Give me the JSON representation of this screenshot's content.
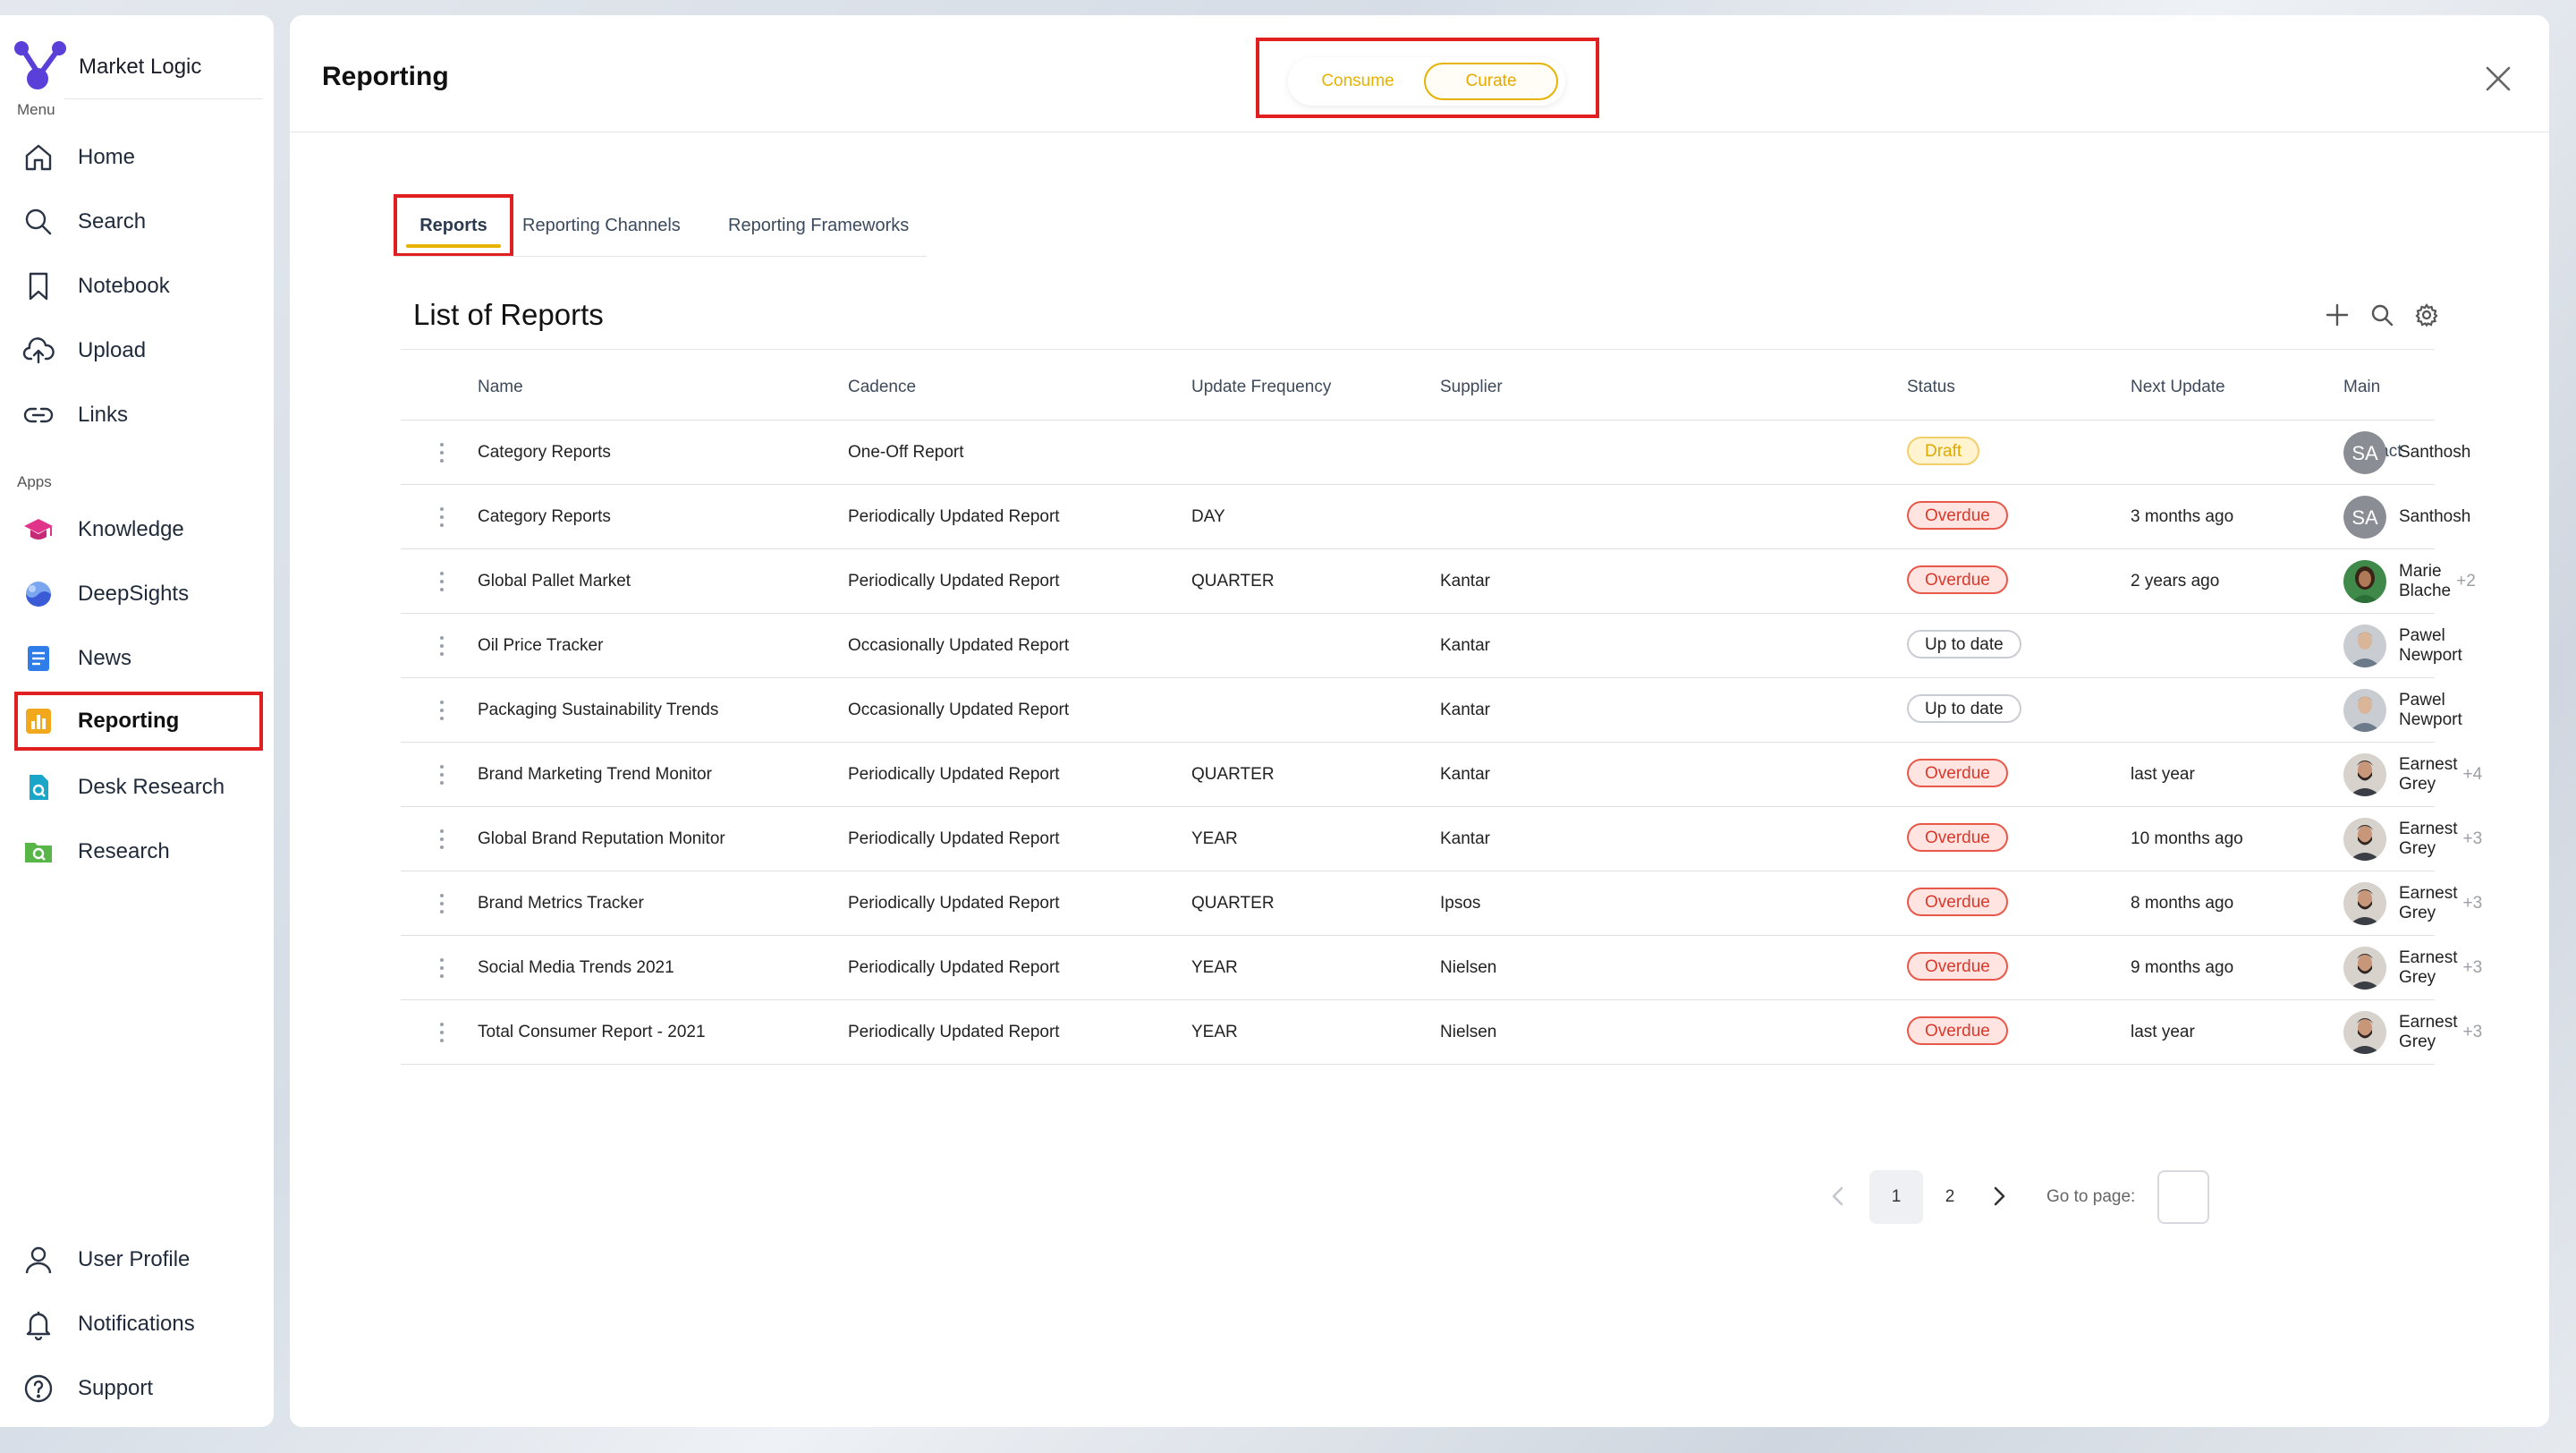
{
  "brand": {
    "name": "Market Logic"
  },
  "sidebar": {
    "menu_label": "Menu",
    "apps_label": "Apps",
    "menu_items": [
      {
        "label": "Home",
        "icon": "home-icon"
      },
      {
        "label": "Search",
        "icon": "search-icon"
      },
      {
        "label": "Notebook",
        "icon": "bookmark-icon"
      },
      {
        "label": "Upload",
        "icon": "cloud-upload-icon"
      },
      {
        "label": "Links",
        "icon": "link-icon"
      }
    ],
    "app_items": [
      {
        "label": "Knowledge",
        "icon": "graduation-cap-icon"
      },
      {
        "label": "DeepSights",
        "icon": "deepsights-icon"
      },
      {
        "label": "News",
        "icon": "news-icon"
      },
      {
        "label": "Reporting",
        "icon": "bar-chart-icon",
        "active": true
      },
      {
        "label": "Desk Research",
        "icon": "desk-research-icon"
      },
      {
        "label": "Research",
        "icon": "research-icon"
      }
    ],
    "bottom_items": [
      {
        "label": "User Profile",
        "icon": "user-icon"
      },
      {
        "label": "Notifications",
        "icon": "bell-icon"
      },
      {
        "label": "Support",
        "icon": "help-icon"
      }
    ]
  },
  "header": {
    "title": "Reporting",
    "mode_toggle": {
      "options": [
        "Consume",
        "Curate"
      ],
      "selected": "Curate"
    }
  },
  "tabs": [
    {
      "label": "Reports",
      "active": true
    },
    {
      "label": "Reporting Channels"
    },
    {
      "label": "Reporting Frameworks"
    }
  ],
  "list": {
    "title": "List of Reports",
    "columns": [
      "Name",
      "Cadence",
      "Update Frequency",
      "Supplier",
      "Status",
      "Next Update",
      "Main Contact"
    ],
    "rows": [
      {
        "name": "Category Reports",
        "cadence": "One-Off Report",
        "frequency": "",
        "supplier": "",
        "status": "Draft",
        "next_update": "",
        "contact": "Santhosh",
        "contact_extra": "",
        "avatar": "SA"
      },
      {
        "name": "Category Reports",
        "cadence": "Periodically Updated Report",
        "frequency": "DAY",
        "supplier": "",
        "status": "Overdue",
        "next_update": "3 months ago",
        "contact": "Santhosh",
        "contact_extra": "",
        "avatar": "SA"
      },
      {
        "name": "Global Pallet Market",
        "cadence": "Periodically Updated Report",
        "frequency": "QUARTER",
        "supplier": "Kantar",
        "status": "Overdue",
        "next_update": "2 years ago",
        "contact": "Marie Blache",
        "contact_extra": "+2",
        "avatar": "photo-woman"
      },
      {
        "name": "Oil Price Tracker",
        "cadence": "Occasionally Updated Report",
        "frequency": "",
        "supplier": "Kantar",
        "status": "Up to date",
        "next_update": "",
        "contact": "Pawel Newport",
        "contact_extra": "",
        "avatar": "photo-man-grey"
      },
      {
        "name": "Packaging Sustainability Trends",
        "cadence": "Occasionally Updated Report",
        "frequency": "",
        "supplier": "Kantar",
        "status": "Up to date",
        "next_update": "",
        "contact": "Pawel Newport",
        "contact_extra": "",
        "avatar": "photo-man-grey"
      },
      {
        "name": "Brand Marketing Trend Monitor",
        "cadence": "Periodically Updated Report",
        "frequency": "QUARTER",
        "supplier": "Kantar",
        "status": "Overdue",
        "next_update": "last year",
        "contact": "Earnest Grey",
        "contact_extra": "+4",
        "avatar": "photo-man-beard"
      },
      {
        "name": "Global Brand Reputation Monitor",
        "cadence": "Periodically Updated Report",
        "frequency": "YEAR",
        "supplier": "Kantar",
        "status": "Overdue",
        "next_update": "10 months ago",
        "contact": "Earnest Grey",
        "contact_extra": "+3",
        "avatar": "photo-man-beard"
      },
      {
        "name": "Brand Metrics Tracker",
        "cadence": "Periodically Updated Report",
        "frequency": "QUARTER",
        "supplier": "Ipsos",
        "status": "Overdue",
        "next_update": "8 months ago",
        "contact": "Earnest Grey",
        "contact_extra": "+3",
        "avatar": "photo-man-beard"
      },
      {
        "name": "Social Media Trends 2021",
        "cadence": "Periodically Updated Report",
        "frequency": "YEAR",
        "supplier": "Nielsen",
        "status": "Overdue",
        "next_update": "9 months ago",
        "contact": "Earnest Grey",
        "contact_extra": "+3",
        "avatar": "photo-man-beard"
      },
      {
        "name": "Total Consumer Report - 2021",
        "cadence": "Periodically Updated Report",
        "frequency": "YEAR",
        "supplier": "Nielsen",
        "status": "Overdue",
        "next_update": "last year",
        "contact": "Earnest Grey",
        "contact_extra": "+3",
        "avatar": "photo-man-beard"
      }
    ]
  },
  "pagination": {
    "pages": [
      "1",
      "2"
    ],
    "current": "1",
    "goto_label": "Go to page:",
    "goto_value": ""
  },
  "colors": {
    "accent": "#e8b200",
    "overdue": "#e8584a",
    "highlight": "#e02020"
  }
}
